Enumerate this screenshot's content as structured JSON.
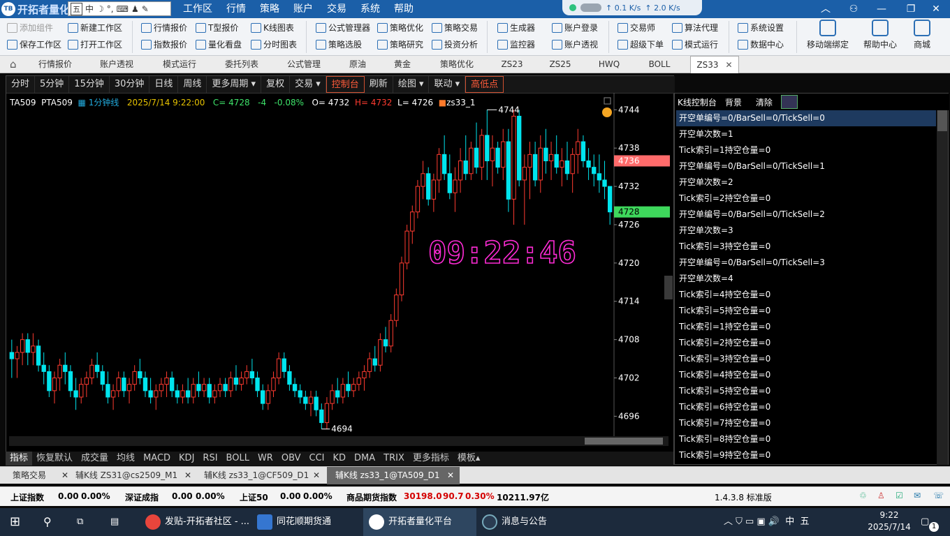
{
  "app": {
    "name": "开拓者量化",
    "logo": "TB",
    "menu": [
      "工作区",
      "行情",
      "策略",
      "账户",
      "交易",
      "系统",
      "帮助"
    ],
    "ime": {
      "cn": "中",
      "items": [
        "五",
        "中",
        "☽",
        "°,",
        "⌨",
        "♟",
        "✎"
      ]
    },
    "net": {
      "up": "↑ 0.1 K/s",
      "down": "↑ 2.0 K/s"
    }
  },
  "toolbar": {
    "row1": [
      "添加组件",
      "新建工作区",
      "行情报价",
      "T型报价",
      "K线图表",
      "公式管理器",
      "策略优化",
      "策略交易",
      "生成器",
      "账户登录",
      "交易师",
      "算法代理",
      "系统设置"
    ],
    "row2": [
      "保存工作区",
      "打开工作区",
      "指数报价",
      "量化看盘",
      "分时图表",
      "策略选股",
      "策略研究",
      "投资分析",
      "监控器",
      "账户透视",
      "超级下单",
      "模式运行",
      "数据中心"
    ],
    "big": [
      "移动端绑定",
      "帮助中心",
      "商城"
    ]
  },
  "tabs": [
    "行情报价",
    "账户透视",
    "模式运行",
    "委托列表",
    "公式管理",
    "原油",
    "黄金",
    "策略优化",
    "ZS23",
    "ZS25",
    "HWQ",
    "BOLL",
    "ZS33"
  ],
  "active_tab": "ZS33",
  "period_bar": [
    "分时",
    "5分钟",
    "15分钟",
    "30分钟",
    "日线",
    "周线",
    "更多周期 ▾",
    "复权",
    "交易 ▾",
    "控制台",
    "刷新",
    "绘图 ▾",
    "联动 ▾",
    "高低点"
  ],
  "chart": {
    "symbol": "TA509",
    "name": "PTA509",
    "period": "1分钟线",
    "datetime": "2025/7/14 9:22:00",
    "close": "C= 4728",
    "change": "-4",
    "pct": "-0.08%",
    "open": "O= 4732",
    "high": "H= 4732",
    "low": "L= 4726",
    "strategy": "zs33_1",
    "max_label": "4744",
    "min_label": "4694",
    "timer": "09:22:46",
    "price_tag_red": "4736",
    "price_tag_green": "4728",
    "axis_labels": [
      "4744",
      "4738",
      "4732",
      "4726",
      "4720",
      "4714",
      "4708",
      "4702",
      "4696"
    ]
  },
  "chart_data": {
    "type": "candlestick",
    "ylim": [
      4692,
      4746
    ],
    "y_ticks": [
      4744,
      4738,
      4732,
      4726,
      4720,
      4714,
      4708,
      4702,
      4696
    ],
    "candles": [
      [
        4706,
        4708,
        4702,
        4705
      ],
      [
        4705,
        4707,
        4702,
        4706
      ],
      [
        4706,
        4709,
        4704,
        4708
      ],
      [
        4708,
        4709,
        4704,
        4706
      ],
      [
        4706,
        4709,
        4704,
        4707
      ],
      [
        4707,
        4708,
        4703,
        4704
      ],
      [
        4704,
        4706,
        4701,
        4703
      ],
      [
        4703,
        4704,
        4699,
        4700
      ],
      [
        4700,
        4703,
        4698,
        4702
      ],
      [
        4702,
        4705,
        4700,
        4704
      ],
      [
        4704,
        4706,
        4701,
        4703
      ],
      [
        4703,
        4704,
        4699,
        4700
      ],
      [
        4700,
        4702,
        4697,
        4699
      ],
      [
        4699,
        4702,
        4698,
        4701
      ],
      [
        4701,
        4703,
        4699,
        4702
      ],
      [
        4702,
        4705,
        4701,
        4704
      ],
      [
        4704,
        4706,
        4702,
        4703
      ],
      [
        4703,
        4704,
        4700,
        4701
      ],
      [
        4701,
        4703,
        4698,
        4699
      ],
      [
        4699,
        4701,
        4697,
        4700
      ],
      [
        4700,
        4703,
        4699,
        4702
      ],
      [
        4702,
        4703,
        4699,
        4700
      ],
      [
        4700,
        4702,
        4698,
        4701
      ],
      [
        4701,
        4704,
        4700,
        4703
      ],
      [
        4703,
        4705,
        4701,
        4702
      ],
      [
        4702,
        4703,
        4699,
        4700
      ],
      [
        4700,
        4702,
        4698,
        4699
      ],
      [
        4699,
        4701,
        4697,
        4700
      ],
      [
        4700,
        4702,
        4699,
        4701
      ],
      [
        4701,
        4703,
        4699,
        4702
      ],
      [
        4702,
        4703,
        4699,
        4700
      ],
      [
        4700,
        4701,
        4698,
        4699
      ],
      [
        4699,
        4701,
        4698,
        4700
      ],
      [
        4700,
        4702,
        4698,
        4699
      ],
      [
        4699,
        4702,
        4698,
        4701
      ],
      [
        4701,
        4703,
        4699,
        4700
      ],
      [
        4700,
        4702,
        4699,
        4701
      ],
      [
        4701,
        4702,
        4698,
        4699
      ],
      [
        4699,
        4701,
        4698,
        4700
      ],
      [
        4700,
        4702,
        4699,
        4701
      ],
      [
        4701,
        4702,
        4699,
        4700
      ],
      [
        4700,
        4703,
        4699,
        4702
      ],
      [
        4702,
        4704,
        4700,
        4701
      ],
      [
        4701,
        4703,
        4700,
        4702
      ],
      [
        4702,
        4704,
        4701,
        4703
      ],
      [
        4703,
        4705,
        4701,
        4702
      ],
      [
        4702,
        4703,
        4699,
        4700
      ],
      [
        4700,
        4701,
        4697,
        4698
      ],
      [
        4698,
        4701,
        4697,
        4700
      ],
      [
        4700,
        4703,
        4699,
        4702
      ],
      [
        4702,
        4706,
        4701,
        4705
      ],
      [
        4705,
        4706,
        4702,
        4703
      ],
      [
        4703,
        4704,
        4700,
        4701
      ],
      [
        4701,
        4702,
        4699,
        4700
      ],
      [
        4700,
        4701,
        4698,
        4699
      ],
      [
        4699,
        4700,
        4697,
        4698
      ],
      [
        4698,
        4700,
        4696,
        4699
      ],
      [
        4699,
        4700,
        4696,
        4697
      ],
      [
        4697,
        4698,
        4694,
        4695
      ],
      [
        4695,
        4699,
        4694,
        4698
      ],
      [
        4698,
        4701,
        4697,
        4700
      ],
      [
        4700,
        4702,
        4698,
        4699
      ],
      [
        4699,
        4702,
        4698,
        4701
      ],
      [
        4701,
        4703,
        4699,
        4700
      ],
      [
        4700,
        4702,
        4699,
        4701
      ],
      [
        4701,
        4703,
        4700,
        4702
      ],
      [
        4702,
        4704,
        4700,
        4703
      ],
      [
        4703,
        4706,
        4702,
        4705
      ],
      [
        4705,
        4707,
        4703,
        4704
      ],
      [
        4704,
        4709,
        4703,
        4708
      ],
      [
        4708,
        4710,
        4706,
        4707
      ],
      [
        4707,
        4712,
        4706,
        4711
      ],
      [
        4711,
        4716,
        4710,
        4715
      ],
      [
        4715,
        4721,
        4714,
        4720
      ],
      [
        4720,
        4726,
        4719,
        4725
      ],
      [
        4725,
        4729,
        4723,
        4728
      ],
      [
        4728,
        4733,
        4727,
        4732
      ],
      [
        4732,
        4736,
        4730,
        4734
      ],
      [
        4734,
        4735,
        4729,
        4730
      ],
      [
        4730,
        4734,
        4728,
        4733
      ],
      [
        4733,
        4738,
        4731,
        4737
      ],
      [
        4737,
        4740,
        4733,
        4734
      ],
      [
        4734,
        4737,
        4730,
        4731
      ],
      [
        4731,
        4735,
        4728,
        4733
      ],
      [
        4733,
        4738,
        4731,
        4736
      ],
      [
        4736,
        4740,
        4733,
        4734
      ],
      [
        4734,
        4739,
        4733,
        4738
      ],
      [
        4738,
        4742,
        4734,
        4735
      ],
      [
        4735,
        4741,
        4733,
        4740
      ],
      [
        4740,
        4744,
        4733,
        4736
      ],
      [
        4736,
        4740,
        4732,
        4738
      ],
      [
        4738,
        4739,
        4734,
        4735
      ],
      [
        4735,
        4741,
        4733,
        4739
      ],
      [
        4739,
        4741,
        4728,
        4730
      ],
      [
        4730,
        4744,
        4726,
        4743
      ],
      [
        4743,
        4744,
        4732,
        4733
      ],
      [
        4733,
        4737,
        4726,
        4735
      ],
      [
        4735,
        4739,
        4730,
        4737
      ],
      [
        4737,
        4739,
        4732,
        4733
      ],
      [
        4733,
        4740,
        4731,
        4738
      ],
      [
        4738,
        4741,
        4734,
        4736
      ],
      [
        4736,
        4739,
        4733,
        4737
      ],
      [
        4737,
        4740,
        4734,
        4735
      ],
      [
        4735,
        4738,
        4732,
        4736
      ],
      [
        4736,
        4739,
        4733,
        4734
      ],
      [
        4734,
        4738,
        4731,
        4737
      ],
      [
        4737,
        4741,
        4734,
        4739
      ],
      [
        4739,
        4740,
        4735,
        4736
      ],
      [
        4736,
        4738,
        4733,
        4735
      ],
      [
        4735,
        4737,
        4732,
        4734
      ],
      [
        4734,
        4737,
        4731,
        4733
      ],
      [
        4733,
        4736,
        4730,
        4732
      ],
      [
        4732,
        4730,
        4726,
        4728
      ]
    ]
  },
  "control_panel": {
    "title": "K线控制台",
    "bg": "背景",
    "clear": "清除",
    "lines": [
      "开空单编号=0/BarSell=0/TickSell=0",
      "开空单次数=1",
      "Tick索引=1持空仓量=0",
      "开空单编号=0/BarSell=0/TickSell=1",
      "开空单次数=2",
      "Tick索引=2持空仓量=0",
      "开空单编号=0/BarSell=0/TickSell=2",
      "开空单次数=3",
      "Tick索引=3持空仓量=0",
      "开空单编号=0/BarSell=0/TickSell=3",
      "开空单次数=4",
      "Tick索引=4持空仓量=0",
      "Tick索引=5持空仓量=0",
      "Tick索引=1持空仓量=0",
      "Tick索引=2持空仓量=0",
      "Tick索引=3持空仓量=0",
      "Tick索引=4持空仓量=0",
      "Tick索引=5持空仓量=0",
      "Tick索引=6持空仓量=0",
      "Tick索引=7持空仓量=0",
      "Tick索引=8持空仓量=0",
      "Tick索引=9持空仓量=0"
    ]
  },
  "indicator_bar": [
    "指标",
    "恢复默认",
    "成交量",
    "均线",
    "MACD",
    "KDJ",
    "RSI",
    "BOLL",
    "WR",
    "OBV",
    "CCI",
    "KD",
    "DMA",
    "TRIX",
    "更多指标",
    "模板▴"
  ],
  "sub_tabs": [
    "策略交易",
    "辅K线 ZS31@cs2509_M1",
    "辅K线 zs33_1@CF509_D1",
    "辅K线 zs33_1@TA509_D1"
  ],
  "status": {
    "sh_name": "上证指数",
    "sh_val": "0.00",
    "sh_pct": "0.00%",
    "sz_name": "深证成指",
    "sz_val": "0.00",
    "sz_pct": "0.00%",
    "s50_name": "上证50",
    "s50_val": "0.00",
    "s50_pct": "0.00%",
    "cf_name": "商品期货指数",
    "cf_val": "30198.0",
    "cf_chg": "90.7",
    "cf_pct": "0.30%",
    "cf_amt": "10211.97亿",
    "version": "1.4.3.8 标准版"
  },
  "taskbar": {
    "apps": [
      "发贴-开拓者社区 - ...",
      "同花顺期货通",
      "开拓者量化平台",
      "消息与公告"
    ],
    "tray": "^ 中 五",
    "time": "9:22",
    "date": "2025/7/14",
    "notify_count": "1"
  },
  "colors": {
    "up": "#ff3b30",
    "down": "#00e5ee",
    "timer": "#ff2bd6",
    "accent": "#1b5fa8"
  }
}
